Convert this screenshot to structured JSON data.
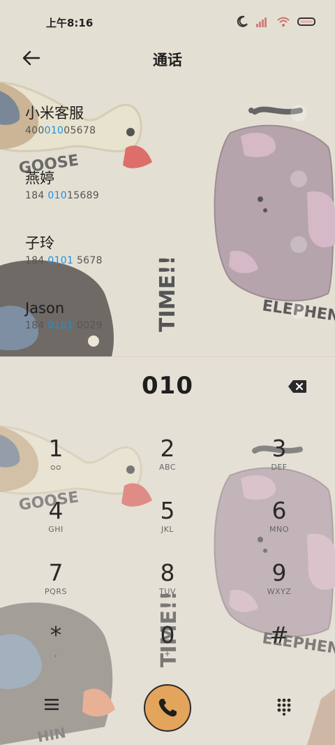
{
  "status": {
    "time": "上午8:16"
  },
  "header": {
    "title": "通话"
  },
  "contacts": [
    {
      "name": "小米客服",
      "num_pre": "400",
      "num_hl": "010",
      "num_post": "05678"
    },
    {
      "name": "燕婷",
      "num_pre": "184 ",
      "num_hl": "010",
      "num_post": "15689"
    },
    {
      "name": "子玲",
      "num_pre": "184 ",
      "num_hl": "0101",
      "num_post": " 5678"
    },
    {
      "name": "Jason",
      "num_pre": "184 ",
      "num_hl": "0101",
      "num_post": " 0029"
    }
  ],
  "dialer": {
    "number": "010",
    "keys": [
      {
        "digit": "1",
        "letters": "ᴑᴑ"
      },
      {
        "digit": "2",
        "letters": "ABC"
      },
      {
        "digit": "3",
        "letters": "DEF"
      },
      {
        "digit": "4",
        "letters": "GHI"
      },
      {
        "digit": "5",
        "letters": "JKL"
      },
      {
        "digit": "6",
        "letters": "MNO"
      },
      {
        "digit": "7",
        "letters": "PQRS"
      },
      {
        "digit": "8",
        "letters": "TUV"
      },
      {
        "digit": "9",
        "letters": "WXYZ"
      },
      {
        "digit": "*",
        "letters": ","
      },
      {
        "digit": "0",
        "letters": "+"
      },
      {
        "digit": "#",
        "letters": ""
      }
    ]
  },
  "wallpaper": {
    "goose_text": "GOOSE",
    "time_text": "TIME!!",
    "elephant_text": "ELEPHEN",
    "chin_text": "HIN"
  },
  "colors": {
    "accent": "#1e8fe0",
    "call": "#e3a45b",
    "bg": "#e4dfd3"
  }
}
